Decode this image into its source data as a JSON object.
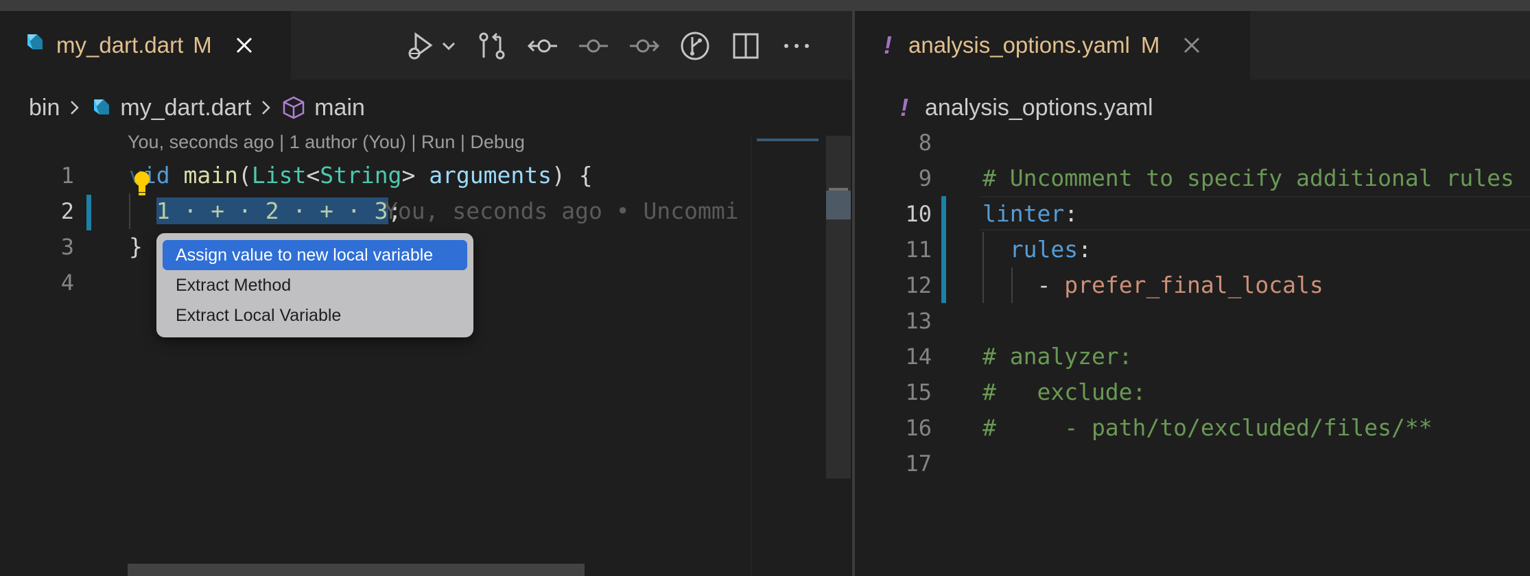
{
  "left_editor": {
    "tab": {
      "title": "my_dart.dart",
      "modified": "M"
    },
    "toolbar": [
      "run-debug-icon",
      "chevron-down-icon",
      "compare-changes-icon",
      "previous-change-icon",
      "commit-icon",
      "next-change-icon",
      "git-graph-icon",
      "split-editor-icon",
      "more-actions-icon"
    ],
    "breadcrumb": {
      "folder": "bin",
      "file": "my_dart.dart",
      "symbol": "main"
    },
    "codelens": "You, seconds ago | 1 author (You) | Run | Debug",
    "lines": [
      {
        "num": "1",
        "pre": "v",
        "kw_rest": "id",
        "sp": " ",
        "fn": "main",
        "p1": "(",
        "ty1": "List",
        "lt": "<",
        "ty2": "String",
        "gt": "> ",
        "var": "arguments",
        "post": ") {"
      },
      {
        "num": "2",
        "indent": "  ",
        "selection": "1 · + · 2 · + · 3",
        "semi": ";",
        "blame": "You, seconds ago • Uncommi"
      },
      {
        "num": "3",
        "text": "}"
      },
      {
        "num": "4",
        "text": ""
      }
    ],
    "quick_fix_menu": {
      "items": [
        "Assign value to new local variable",
        "Extract Method",
        "Extract Local Variable"
      ],
      "active_index": 0
    }
  },
  "right_editor": {
    "tab": {
      "title": "analysis_options.yaml",
      "modified": "M",
      "icon_glyph": "!"
    },
    "breadcrumb": {
      "file": "analysis_options.yaml",
      "icon_glyph": "!"
    },
    "lines": [
      {
        "num": "8",
        "text": ""
      },
      {
        "num": "9",
        "text": "# Uncomment to specify additional rules"
      },
      {
        "num": "10",
        "key": "linter",
        "colon": ":"
      },
      {
        "num": "11",
        "indent": "  ",
        "key": "rules",
        "colon": ":"
      },
      {
        "num": "12",
        "indent": "    ",
        "dash": "- ",
        "value": "prefer_final_locals"
      },
      {
        "num": "13",
        "text": ""
      },
      {
        "num": "14",
        "text": "# analyzer:"
      },
      {
        "num": "15",
        "text": "#   exclude:"
      },
      {
        "num": "16",
        "text": "#     - path/to/excluded/files/**"
      },
      {
        "num": "17",
        "text": ""
      }
    ]
  },
  "colors": {
    "background": "#1e1e1e",
    "modified_tab": "#e2c08d",
    "selection": "#264f78",
    "menu_active": "#2f6fd6",
    "git_gutter": "#1b81a8",
    "yaml_icon": "#a074c4",
    "comment": "#6a9955"
  }
}
